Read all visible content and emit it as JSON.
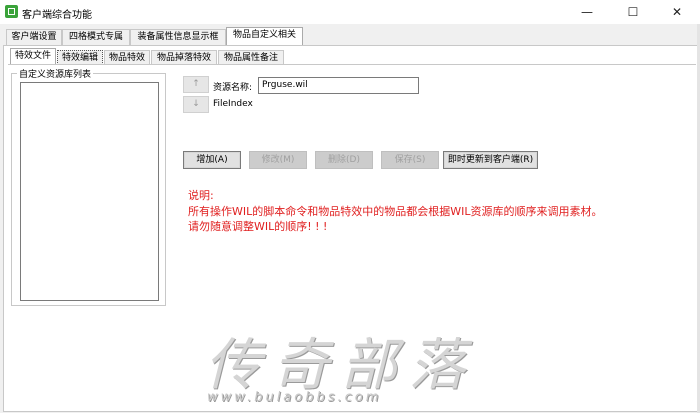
{
  "window": {
    "title": "客户端综合功能",
    "minimize": "—",
    "maximize": "☐",
    "close": "✕"
  },
  "main_tabs": [
    {
      "label": "客户端设置"
    },
    {
      "label": "四格模式专属"
    },
    {
      "label": "装备属性信息显示框"
    },
    {
      "label": "物品自定义相关",
      "active": true
    }
  ],
  "sub_tabs": [
    {
      "label": "特效文件",
      "active": true
    },
    {
      "label": "特效编辑"
    },
    {
      "label": "物品特效"
    },
    {
      "label": "物品掉落特效"
    },
    {
      "label": "物品属性备注"
    }
  ],
  "resource_panel": {
    "group_label": "自定义资源库列表",
    "items": []
  },
  "arrows": {
    "up": "↑",
    "down": "↓"
  },
  "form": {
    "name_label": "资源名称:",
    "name_value": "Prguse.wil",
    "index_label": "FileIndex"
  },
  "buttons": {
    "add": "增加(A)",
    "modify": "修改(M)",
    "delete": "删除(D)",
    "save": "保存(S)",
    "update_client": "即时更新到客户端(R)"
  },
  "notes": {
    "title": "说明:",
    "line1": "所有操作WIL的脚本命令和物品特效中的物品都会根据WIL资源库的顺序来调用素材。",
    "line2": "请勿随意调整WIL的顺序! ! !"
  },
  "watermark": {
    "text": "传奇部落",
    "url": "www.bulaobbs.com"
  },
  "colors": {
    "notes_text": "#e02020",
    "app_icon": "#3aa33a"
  }
}
